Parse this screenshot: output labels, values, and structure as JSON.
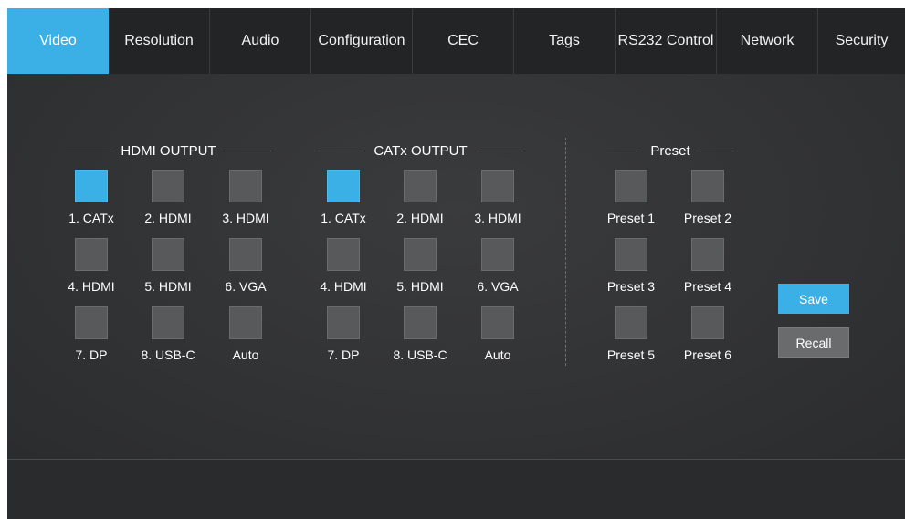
{
  "tabs": [
    {
      "label": "Video",
      "active": true
    },
    {
      "label": "Resolution",
      "active": false
    },
    {
      "label": "Audio",
      "active": false
    },
    {
      "label": "Configuration",
      "active": false
    },
    {
      "label": "CEC",
      "active": false
    },
    {
      "label": "Tags",
      "active": false
    },
    {
      "label": "RS232 Control",
      "active": false
    },
    {
      "label": "Network",
      "active": false
    },
    {
      "label": "Security",
      "active": false
    }
  ],
  "hdmi_output": {
    "title": "HDMI OUTPUT",
    "sources": [
      {
        "label": "1. CATx",
        "selected": true
      },
      {
        "label": "2. HDMI",
        "selected": false
      },
      {
        "label": "3. HDMI",
        "selected": false
      },
      {
        "label": "4. HDMI",
        "selected": false
      },
      {
        "label": "5. HDMI",
        "selected": false
      },
      {
        "label": "6. VGA",
        "selected": false
      },
      {
        "label": "7. DP",
        "selected": false
      },
      {
        "label": "8. USB-C",
        "selected": false
      },
      {
        "label": "Auto",
        "selected": false
      }
    ]
  },
  "catx_output": {
    "title": "CATx  OUTPUT",
    "sources": [
      {
        "label": "1. CATx",
        "selected": true
      },
      {
        "label": "2. HDMI",
        "selected": false
      },
      {
        "label": "3. HDMI",
        "selected": false
      },
      {
        "label": "4. HDMI",
        "selected": false
      },
      {
        "label": "5. HDMI",
        "selected": false
      },
      {
        "label": "6. VGA",
        "selected": false
      },
      {
        "label": "7. DP",
        "selected": false
      },
      {
        "label": "8. USB-C",
        "selected": false
      },
      {
        "label": "Auto",
        "selected": false
      }
    ]
  },
  "preset": {
    "title": "Preset",
    "items": [
      {
        "label": "Preset 1"
      },
      {
        "label": "Preset 2"
      },
      {
        "label": "Preset 3"
      },
      {
        "label": "Preset 4"
      },
      {
        "label": "Preset 5"
      },
      {
        "label": "Preset 6"
      }
    ],
    "save_label": "Save",
    "recall_label": "Recall"
  },
  "colors": {
    "accent": "#3bb0e6",
    "tile": "#58595b",
    "background": "#2f3032"
  }
}
